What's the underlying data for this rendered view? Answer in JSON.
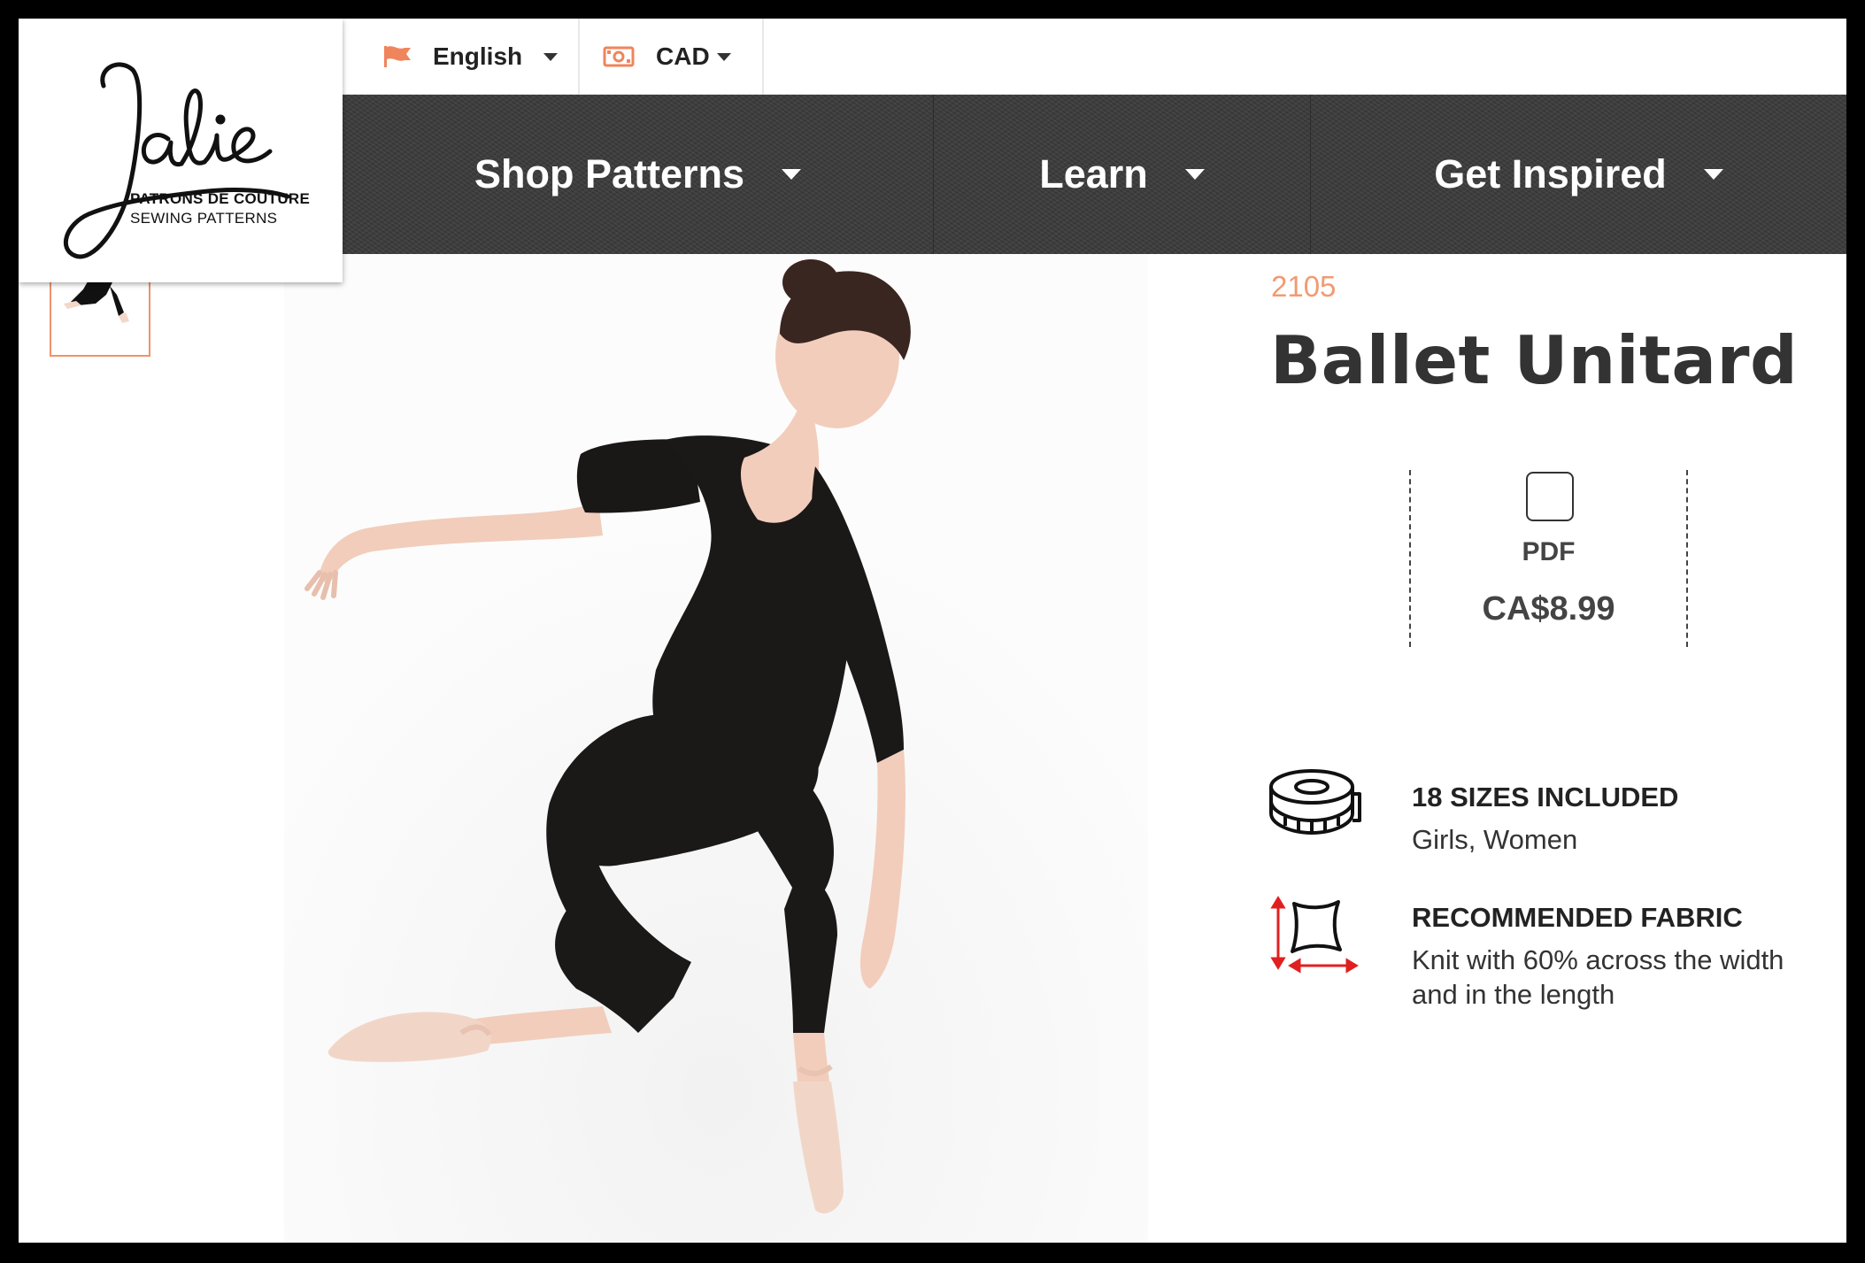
{
  "header": {
    "logo": {
      "script": "Jalie",
      "line1": "PATRONS DE COUTURE",
      "line2": "SEWING PATTERNS"
    },
    "language": {
      "label": "English",
      "icon": "flag-icon"
    },
    "currency": {
      "label": "CAD",
      "icon": "banknote-icon"
    },
    "accent_color": "#f0845c"
  },
  "nav": {
    "items": [
      {
        "label": "Shop Patterns"
      },
      {
        "label": "Learn"
      },
      {
        "label": "Get Inspired"
      }
    ]
  },
  "product": {
    "sku": "2105",
    "title": "Ballet Unitard",
    "format": {
      "label": "PDF",
      "price": "CA$8.99",
      "selected": false
    },
    "features": [
      {
        "icon": "measuring-tape-icon",
        "title": "18 SIZES INCLUDED",
        "text": "Girls, Women"
      },
      {
        "icon": "stretch-fabric-icon",
        "title": "RECOMMENDED FABRIC",
        "text": "Knit with 60% across the width and in the length"
      }
    ]
  }
}
